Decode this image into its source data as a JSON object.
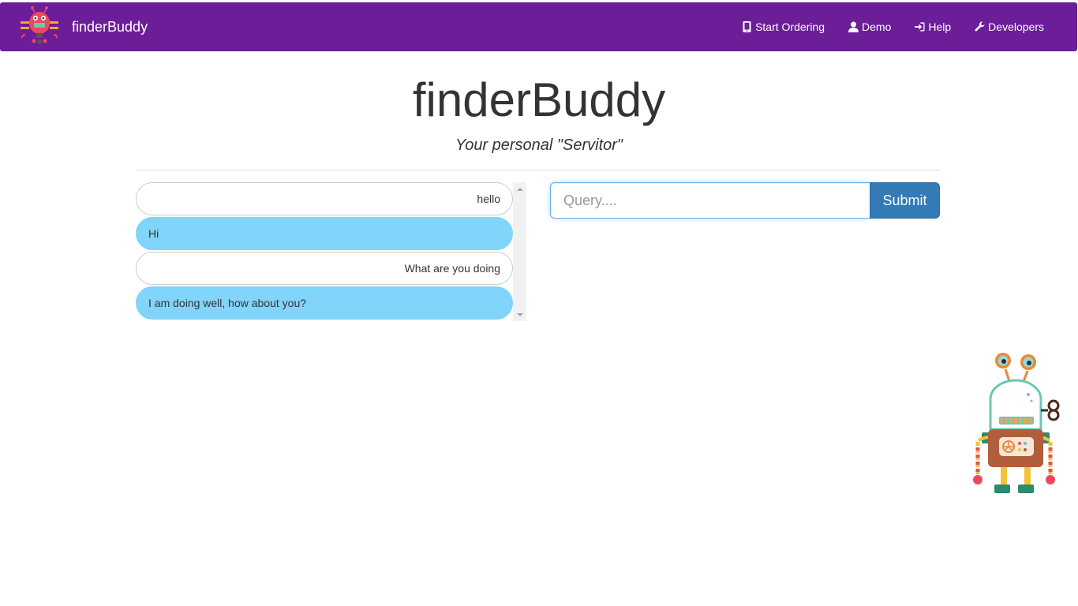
{
  "app": {
    "brand": "finderBuddy",
    "brand_color": "#6c1d98"
  },
  "nav": {
    "items": [
      {
        "label": "Start Ordering",
        "icon": "phone-icon"
      },
      {
        "label": "Demo",
        "icon": "user-icon"
      },
      {
        "label": "Help",
        "icon": "sign-in-icon"
      },
      {
        "label": "Developers",
        "icon": "wrench-icon"
      }
    ]
  },
  "header": {
    "title": "finderBuddy",
    "subtitle": "Your personal \"Servitor\""
  },
  "chat": {
    "messages": [
      {
        "sender": "user",
        "text": "hello"
      },
      {
        "sender": "bot",
        "text": "Hi"
      },
      {
        "sender": "user",
        "text": "What are you doing"
      },
      {
        "sender": "bot",
        "text": "I am doing well, how about you?"
      }
    ],
    "bot_bubble_color": "#81d4fa"
  },
  "query": {
    "placeholder": "Query....",
    "value": "",
    "submit_label": "Submit",
    "submit_color": "#337ab7"
  }
}
